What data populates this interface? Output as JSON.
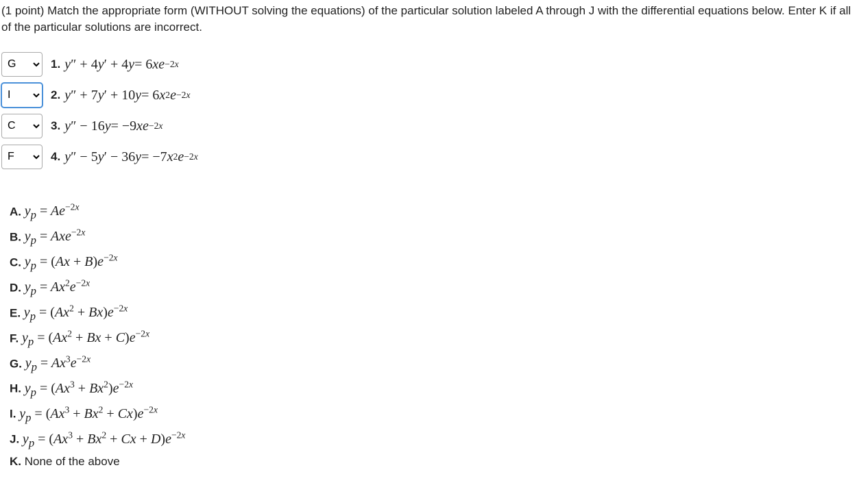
{
  "instructions": "(1 point) Match the appropriate form (WITHOUT solving the equations) of the particular solution labeled A through J with the differential equations below. Enter K if all of the particular solutions are incorrect.",
  "questions": [
    {
      "selected": "G",
      "num": "1.",
      "eq_html": "<i>y</i>″ + 4<i>y</i>′ + 4<i>y</i> = 6<i>xe</i><sup>−2<i>x</i></sup>",
      "active": false
    },
    {
      "selected": "I",
      "num": "2.",
      "eq_html": "<i>y</i>″ + 7<i>y</i>′ + 10<i>y</i> = 6<i>x</i><sup>2</sup><i>e</i><sup>−2<i>x</i></sup>",
      "active": true
    },
    {
      "selected": "C",
      "num": "3.",
      "eq_html": "<i>y</i>″ − 16<i>y</i> = −9<i>xe</i><sup>−2<i>x</i></sup>",
      "active": false
    },
    {
      "selected": "F",
      "num": "4.",
      "eq_html": "<i>y</i>″ − 5<i>y</i>′ − 36<i>y</i> = −7<i>x</i><sup>2</sup><i>e</i><sup>−2<i>x</i></sup>",
      "active": false
    }
  ],
  "answers": [
    {
      "label": "A.",
      "expr_html": "<span class='math'>y<sub>p</sub> <span class='rm'>=</span> Ae<sup>−<span class='rm'>2</span><span class='it'>x</span></sup></span>"
    },
    {
      "label": "B.",
      "expr_html": "<span class='math'>y<sub>p</sub> <span class='rm'>=</span> Axe<sup>−<span class='rm'>2</span><span class='it'>x</span></sup></span>"
    },
    {
      "label": "C.",
      "expr_html": "<span class='math'>y<sub>p</sub> <span class='rm'>=</span> <span class='rm'>(</span>Ax <span class='rm'>+</span> B<span class='rm'>)</span>e<sup>−<span class='rm'>2</span><span class='it'>x</span></sup></span>"
    },
    {
      "label": "D.",
      "expr_html": "<span class='math'>y<sub>p</sub> <span class='rm'>=</span> Ax<sup><span class='rm'>2</span></sup>e<sup>−<span class='rm'>2</span><span class='it'>x</span></sup></span>"
    },
    {
      "label": "E.",
      "expr_html": "<span class='math'>y<sub>p</sub> <span class='rm'>=</span> <span class='rm'>(</span>Ax<sup><span class='rm'>2</span></sup> <span class='rm'>+</span> Bx<span class='rm'>)</span>e<sup>−<span class='rm'>2</span><span class='it'>x</span></sup></span>"
    },
    {
      "label": "F.",
      "expr_html": "<span class='math'>y<sub>p</sub> <span class='rm'>=</span> <span class='rm'>(</span>Ax<sup><span class='rm'>2</span></sup> <span class='rm'>+</span> Bx <span class='rm'>+</span> C<span class='rm'>)</span>e<sup>−<span class='rm'>2</span><span class='it'>x</span></sup></span>"
    },
    {
      "label": "G.",
      "expr_html": "<span class='math'>y<sub>p</sub> <span class='rm'>=</span> Ax<sup><span class='rm'>3</span></sup>e<sup>−<span class='rm'>2</span><span class='it'>x</span></sup></span>"
    },
    {
      "label": "H.",
      "expr_html": "<span class='math'>y<sub>p</sub> <span class='rm'>=</span> <span class='rm'>(</span>Ax<sup><span class='rm'>3</span></sup> <span class='rm'>+</span> Bx<sup><span class='rm'>2</span></sup><span class='rm'>)</span>e<sup>−<span class='rm'>2</span><span class='it'>x</span></sup></span>"
    },
    {
      "label": "I.",
      "expr_html": "<span class='math'>y<sub>p</sub> <span class='rm'>=</span> <span class='rm'>(</span>Ax<sup><span class='rm'>3</span></sup> <span class='rm'>+</span> Bx<sup><span class='rm'>2</span></sup> <span class='rm'>+</span> Cx<span class='rm'>)</span>e<sup>−<span class='rm'>2</span><span class='it'>x</span></sup></span>"
    },
    {
      "label": "J.",
      "expr_html": "<span class='math'>y<sub>p</sub> <span class='rm'>=</span> <span class='rm'>(</span>Ax<sup><span class='rm'>3</span></sup> <span class='rm'>+</span> Bx<sup><span class='rm'>2</span></sup> <span class='rm'>+</span> Cx <span class='rm'>+</span> D<span class='rm'>)</span>e<sup>−<span class='rm'>2</span><span class='it'>x</span></sup></span>"
    },
    {
      "label": "K.",
      "expr_html": "None of the above"
    }
  ],
  "options": [
    "?",
    "A",
    "B",
    "C",
    "D",
    "E",
    "F",
    "G",
    "H",
    "I",
    "J",
    "K"
  ]
}
